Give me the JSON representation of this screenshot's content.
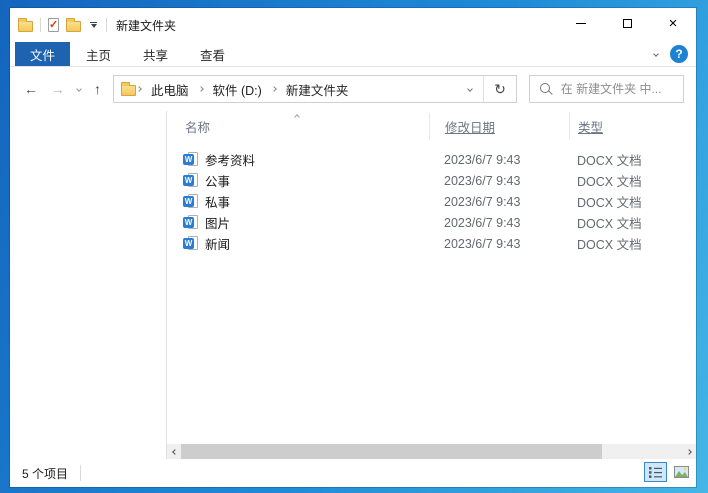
{
  "window": {
    "title": "新建文件夹",
    "controls": {
      "minimize": "minimize",
      "maximize": "maximize",
      "close_glyph": "×"
    }
  },
  "quick_access": {
    "properties_check_glyph": "✓"
  },
  "ribbon": {
    "tabs": [
      {
        "label": "文件",
        "active": true
      },
      {
        "label": "主页",
        "active": false
      },
      {
        "label": "共享",
        "active": false
      },
      {
        "label": "查看",
        "active": false
      }
    ],
    "help_glyph": "?"
  },
  "address_bar": {
    "back_glyph": "←",
    "forward_glyph": "→",
    "up_glyph": "↑",
    "refresh_glyph": "↻",
    "breadcrumb": [
      "此电脑",
      "软件 (D:)",
      "新建文件夹"
    ],
    "search_placeholder": "在 新建文件夹 中..."
  },
  "file_list": {
    "columns": [
      {
        "label": "名称",
        "underlined": false,
        "sort": "asc"
      },
      {
        "label": "修改日期",
        "underlined": true
      },
      {
        "label": "类型",
        "underlined": true
      }
    ],
    "rows": [
      {
        "name": "参考资料",
        "date": "2023/6/7 9:43",
        "type": "DOCX 文档"
      },
      {
        "name": "公事",
        "date": "2023/6/7 9:43",
        "type": "DOCX 文档"
      },
      {
        "name": "私事",
        "date": "2023/6/7 9:43",
        "type": "DOCX 文档"
      },
      {
        "name": "图片",
        "date": "2023/6/7 9:43",
        "type": "DOCX 文档"
      },
      {
        "name": "新闻",
        "date": "2023/6/7 9:43",
        "type": "DOCX 文档"
      }
    ],
    "word_badge": "W"
  },
  "status_bar": {
    "items_count": "5 个项目"
  },
  "colors": {
    "file_tab_blue": "#1e63b0",
    "help_blue": "#1d82d2",
    "word_blue": "#2b7cd3",
    "active_view_bg": "#cce8ff",
    "active_view_border": "#3f86c6",
    "desktop_top": "#1465bd",
    "desktop_bottom": "#45b6e6",
    "folder_yellow": "#f3c85c"
  }
}
